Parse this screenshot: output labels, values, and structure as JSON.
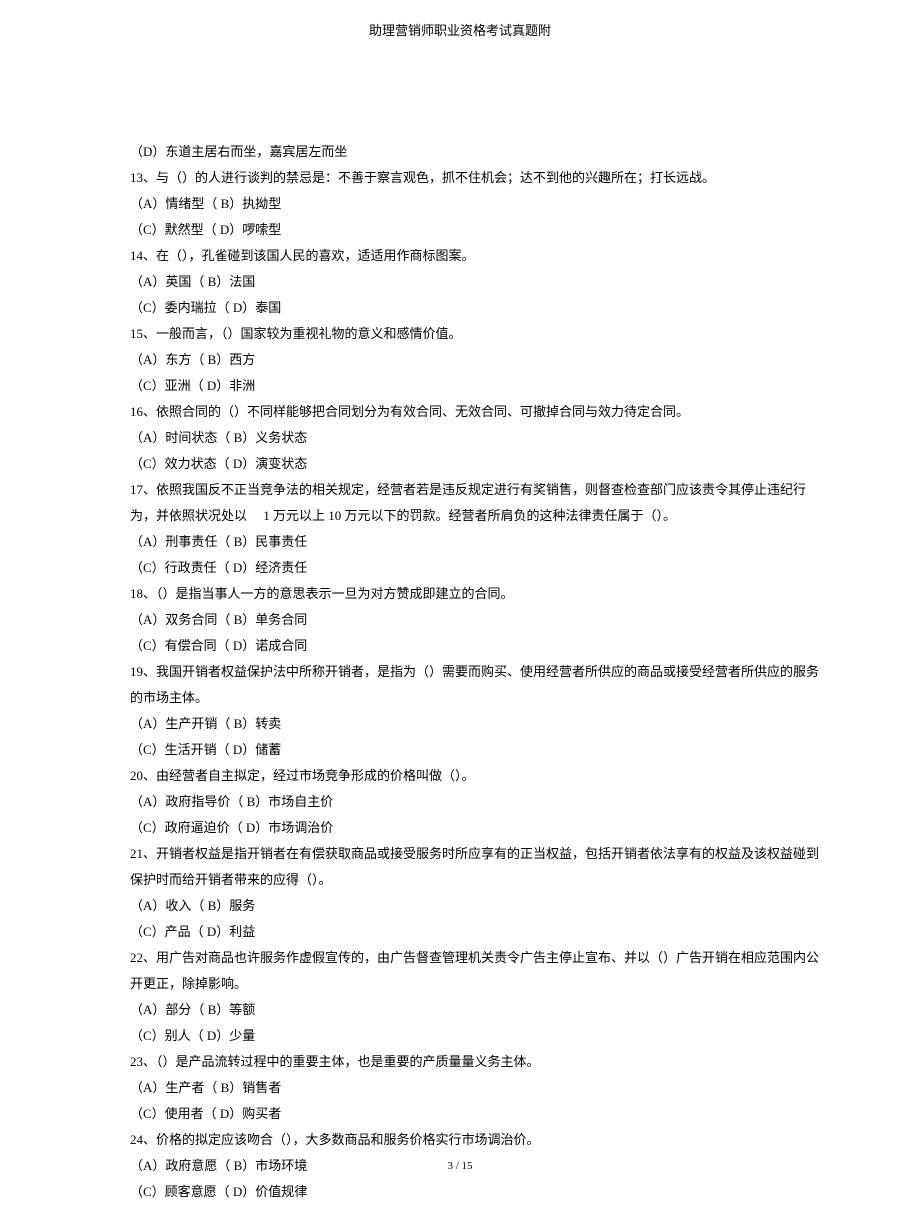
{
  "header": {
    "title": "助理营销师职业资格考试真题附"
  },
  "lines": [
    "（D）东道主居右而坐，嘉宾居左而坐",
    "13、与（）的人进行谈判的禁忌是：不善于察言观色，抓不住机会；达不到他的兴趣所在；打长远战。",
    "（A）情绪型（ B）执拗型",
    "（C）默然型（ D）啰嗦型",
    "14、在（），孔雀碰到该国人民的喜欢，适适用作商标图案。",
    "（A）英国（ B）法国",
    "（C）委内瑞拉（ D）泰国",
    "15、一般而言，（）国家较为重视礼物的意义和感情价值。",
    "（A）东方（ B）西方",
    "（C）亚洲（ D）非洲",
    "16、依照合同的（）不同样能够把合同划分为有效合同、无效合同、可撤掉合同与效力待定合同。",
    "（A）时间状态（ B）义务状态",
    "（C）效力状态（ D）演变状态",
    "17、依照我国反不正当竞争法的相关规定，经营者若是违反规定进行有奖销售，则督查检查部门应该责令其停止违纪行为，并依照状况处以　 1 万元以上  10 万元以下的罚款。经营者所肩负的这种法律责任属于（）。",
    "（A）刑事责任（ B）民事责任",
    "（C）行政责任（ D）经济责任",
    "18、（）是指当事人一方的意思表示一旦为对方赞成即建立的合同。",
    "（A）双务合同（ B）单务合同",
    "（C）有偿合同（ D）诺成合同",
    "19、我国开销者权益保护法中所称开销者，是指为（）需要而购买、使用经营者所供应的商品或接受经营者所供应的服务的市场主体。",
    "（A）生产开销（ B）转卖",
    "（C）生活开销（ D）储蓄",
    "20、由经营者自主拟定，经过市场竞争形成的价格叫做（）。",
    "（A）政府指导价（ B）市场自主价",
    "（C）政府逼迫价（ D）市场调治价",
    "21、开销者权益是指开销者在有偿获取商品或接受服务时所应享有的正当权益，包括开销者依法享有的权益及该权益碰到保护时而给开销者带来的应得（）。",
    "（A）收入（ B）服务",
    "（C）产品（ D）利益",
    "22、用广告对商品也许服务作虚假宣传的，由广告督查管理机关责令广告主停止宣布、并以（）广告开销在相应范围内公开更正，除掉影响。",
    "（A）部分（ B）等额",
    "（C）别人（ D）少量",
    "23、（）是产品流转过程中的重要主体，也是重要的产质量量义务主体。",
    "（A）生产者（ B）销售者",
    "（C）使用者（ D）购买者",
    "24、价格的拟定应该吻合（），大多数商品和服务价格实行市场调治价。",
    "（A）政府意愿（ B）市场环境",
    "（C）顾客意愿（ D）价值规律"
  ],
  "footer": {
    "page": "3 / 15"
  }
}
